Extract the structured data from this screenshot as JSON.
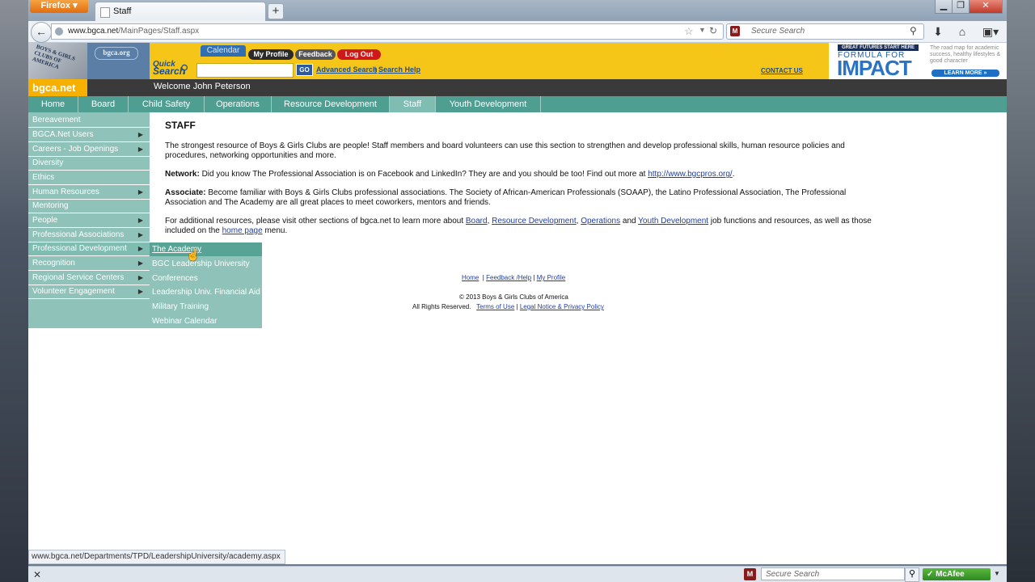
{
  "browser": {
    "app_button": "Firefox",
    "tab_title": "Staff",
    "new_tab": "+",
    "url_domain": "www.bgca.net",
    "url_path": "/MainPages/Staff.aspx",
    "search_placeholder": "Secure Search",
    "status_url": "www.bgca.net/Departments/TPD/LeadershipUniversity/academy.aspx",
    "bottom_search_placeholder": "Secure Search",
    "mcafee_label": "McAfee"
  },
  "header": {
    "logo_text": "BOYS & GIRLS CLUBS OF AMERICA",
    "bgca_org": "bgca.org",
    "tabs": {
      "calendar": "Calendar",
      "my_profile": "My Profile",
      "feedback": "Feedback",
      "logout": "Log Out"
    },
    "quick_search_line1": "Quick",
    "quick_search_line2": "Search",
    "go": "GO",
    "advanced_search": "Advanced Search",
    "search_help": "Search Help",
    "separator": "|",
    "contact_us": "CONTACT US",
    "site_name": "bgca.net",
    "welcome": "Welcome John Peterson"
  },
  "ad": {
    "top": "GREAT FUTURES START HERE",
    "formula": "FORMULA FOR",
    "impact": "IMPACT",
    "side": "The road map for academic success, healthy lifestyles & good character",
    "learn_more": "LEARN MORE »"
  },
  "menu": [
    "Home",
    "Board",
    "Child Safety",
    "Operations",
    "Resource Development",
    "Staff",
    "Youth Development"
  ],
  "leftnav": [
    {
      "label": "Bereavement",
      "arrow": ""
    },
    {
      "label": "BGCA.Net Users",
      "arrow": "▶"
    },
    {
      "label": "Careers - Job Openings",
      "arrow": "▶"
    },
    {
      "label": "Diversity",
      "arrow": ""
    },
    {
      "label": "Ethics",
      "arrow": ""
    },
    {
      "label": "Human Resources",
      "arrow": "▶"
    },
    {
      "label": "Mentoring",
      "arrow": ""
    },
    {
      "label": "People",
      "arrow": "▶"
    },
    {
      "label": "Professional Associations",
      "arrow": "▶"
    },
    {
      "label": "Professional Development",
      "arrow": "▶"
    },
    {
      "label": "Recognition",
      "arrow": "▶"
    },
    {
      "label": "Regional Service Centers",
      "arrow": "▶"
    },
    {
      "label": "Volunteer Engagement",
      "arrow": "▶"
    }
  ],
  "submenu": [
    "The Academy",
    "BGC Leadership University",
    "Conferences",
    "Leadership Univ. Financial Aid",
    "Military Training",
    "Webinar Calendar"
  ],
  "content": {
    "title": "STAFF",
    "intro": "The strongest resource of Boys & Girls Clubs are people!  Staff members and board volunteers can use this section to strengthen and develop professional skills, human resource policies and procedures, networking opportunities and more.",
    "network_label": "Network:",
    "network_text": " Did you know The Professional Association is on Facebook and LinkedIn? They are and you should be too! Find out more at ",
    "network_link": "http://www.bgcpros.org/",
    "network_end": ".",
    "associate_label": "Associate:",
    "associate_text": " Become familiar with Boys & Girls Clubs professional associations. The Society of African-American Professionals (SOAAP), the Latino Professional Association, The Professional Association and The Academy are all great places to meet coworkers, mentors and friends.",
    "additional_1": "For additional resources, please visit other sections of bgca.net to learn more about ",
    "link_board": "Board",
    "comma": ", ",
    "link_resource": "Resource Development",
    "link_operations": "Operations",
    "and": " and ",
    "link_youth": "Youth Development",
    "additional_2": " job functions and resources, as well as those included on the ",
    "link_home_page": "home page",
    "additional_3": " menu."
  },
  "footer": {
    "home": "Home",
    "feedback_help": "Feedback /Help",
    "my_profile": "My Profile",
    "sep": "|",
    "copyright": "© 2013 Boys & Girls Clubs of America",
    "rights": "All Rights Reserved.",
    "terms": "Terms of Use",
    "legal": "Legal Notice & Privacy Policy"
  }
}
